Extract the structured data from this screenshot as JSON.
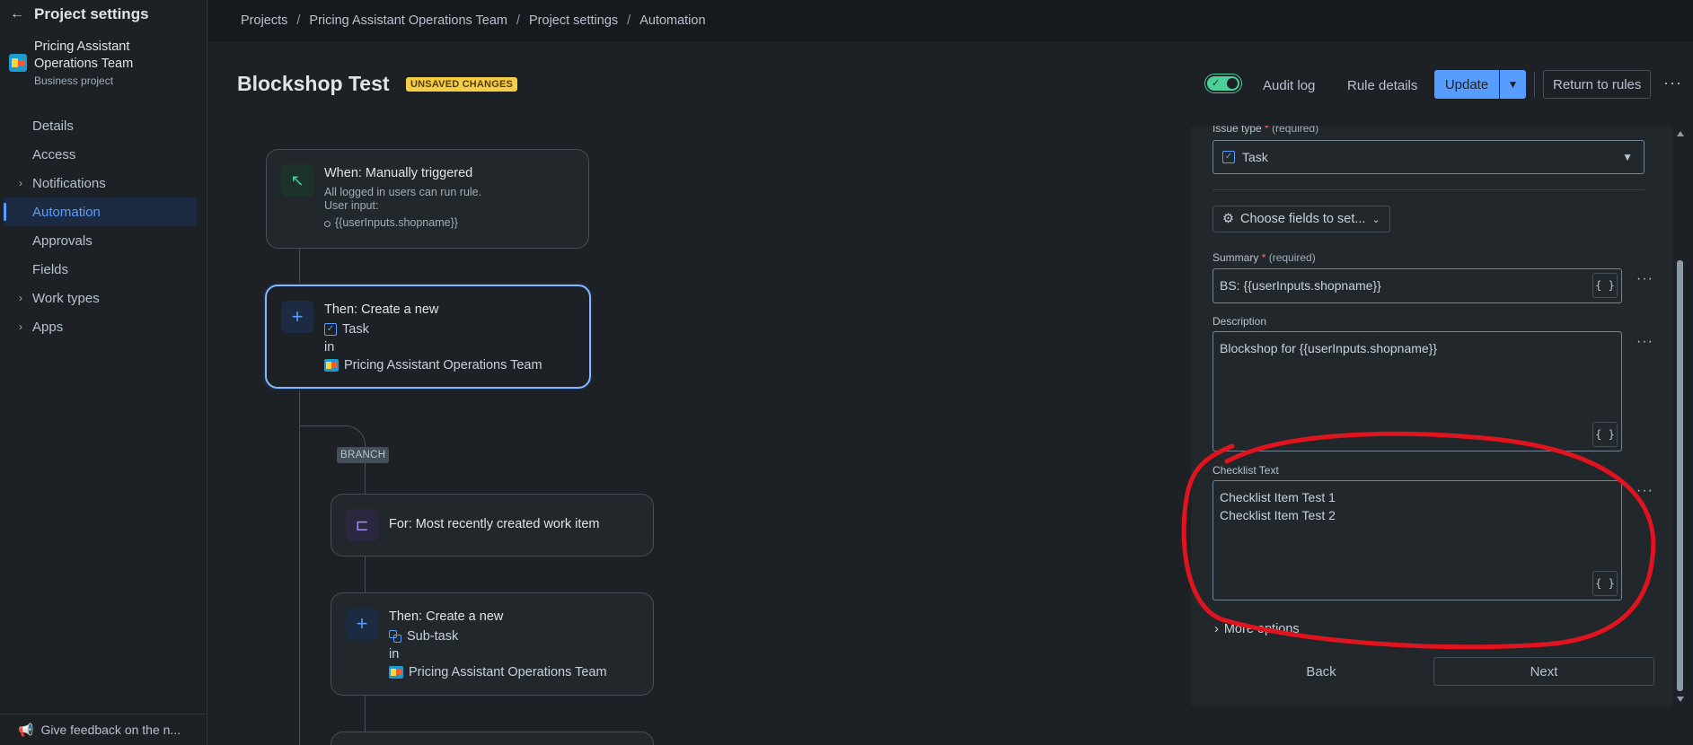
{
  "sidebar": {
    "title": "Project settings",
    "project_name": "Pricing Assistant Operations Team",
    "project_type": "Business project",
    "items": [
      {
        "label": "Details"
      },
      {
        "label": "Access"
      },
      {
        "label": "Notifications"
      },
      {
        "label": "Automation"
      },
      {
        "label": "Approvals"
      },
      {
        "label": "Fields"
      },
      {
        "label": "Work types"
      },
      {
        "label": "Apps"
      }
    ],
    "feedback": "Give feedback on the n..."
  },
  "breadcrumb": [
    "Projects",
    "Pricing Assistant Operations Team",
    "Project settings",
    "Automation"
  ],
  "header": {
    "rule_name": "Blockshop Test",
    "unsaved_badge": "UNSAVED CHANGES",
    "audit_log": "Audit log",
    "rule_details": "Rule details",
    "update": "Update",
    "return_to_rules": "Return to rules",
    "more": "···"
  },
  "flow": {
    "trigger": {
      "title": "When: Manually triggered",
      "line1": "All logged in users can run rule.",
      "line2": "User input:",
      "bullet": "{{userInputs.shopname}}"
    },
    "action1": {
      "title": "Then: Create a new",
      "type": "Task",
      "in": "in",
      "project": "Pricing Assistant Operations Team"
    },
    "branch_label": "BRANCH",
    "branch": {
      "title": "For: Most recently created work item"
    },
    "action2": {
      "title": "Then: Create a new",
      "type": "Sub-task",
      "in": "in",
      "project": "Pricing Assistant Operations Team"
    }
  },
  "panel": {
    "issue_type_label": "Issue type",
    "issue_type_req": "(required)",
    "issue_type_value": "Task",
    "choose_fields": "Choose fields to set...",
    "summary_label": "Summary",
    "summary_req": "(required)",
    "summary_value": "BS: {{userInputs.shopname}}",
    "description_label": "Description",
    "description_value": "Blockshop for {{userInputs.shopname}}",
    "checklist_label": "Checklist Text",
    "checklist_lines": [
      "Checklist Item Test 1",
      "Checklist Item Test 2"
    ],
    "more_options": "More options",
    "back": "Back",
    "next": "Next",
    "brace_glyph": "{ }"
  },
  "colors": {
    "background": "#1d2125",
    "accent": "#579dff",
    "badge": "#f5cd47",
    "toggle_on": "#4bce97",
    "annotation": "#e0141e"
  }
}
